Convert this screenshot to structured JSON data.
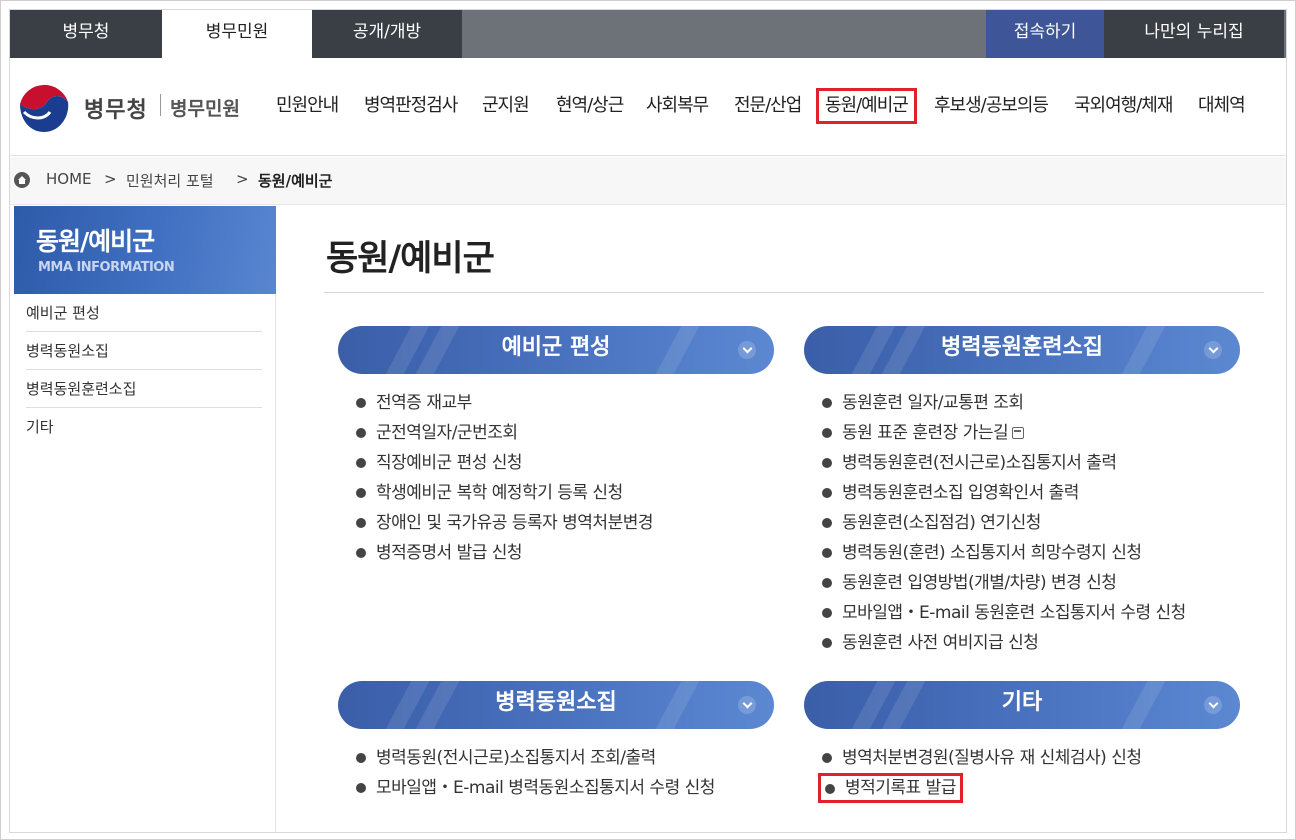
{
  "topbar": {
    "tabs": [
      "병무청",
      "병무민원",
      "공개/개방"
    ],
    "active_tab": "병무민원",
    "login": "접속하기",
    "my_nuri": "나만의 누리집"
  },
  "header": {
    "logo_text": "병무청",
    "logo_sub": "병무민원",
    "nav": [
      "민원안내",
      "병역판정검사",
      "군지원",
      "현역/상근",
      "사회복무",
      "전문/산업",
      "동원/예비군",
      "후보생/공보의등",
      "국외여행/체재",
      "대체역"
    ],
    "active_nav": "동원/예비군"
  },
  "breadcrumb": {
    "home": "HOME",
    "sep": ">",
    "level1": "민원처리 포털",
    "current": "동원/예비군"
  },
  "sidebar": {
    "title": "동원/예비군",
    "subtitle": "MMA INFORMATION",
    "items": [
      "예비군 편성",
      "병력동원소집",
      "병력동원훈련소집",
      "기타"
    ]
  },
  "main": {
    "title": "동원/예비군",
    "sections": [
      {
        "title": "예비군 편성",
        "items": [
          "전역증 재교부",
          "군전역일자/군번조회",
          "직장예비군 편성 신청",
          "학생예비군 복학 예정학기 등록 신청",
          "장애인 및 국가유공 등록자 병역처분변경",
          "병적증명서 발급 신청"
        ]
      },
      {
        "title": "병력동원훈련소집",
        "items": [
          "동원훈련 일자/교통편 조회",
          "동원 표준 훈련장 가는길",
          "병력동원훈련(전시근로)소집통지서 출력",
          "병력동원훈련소집 입영확인서 출력",
          "동원훈련(소집점검) 연기신청",
          "병력동원(훈련) 소집통지서 희망수령지 신청",
          "동원훈련 입영방법(개별/차량) 변경 신청",
          "모바일앱・E-mail 동원훈련 소집통지서 수령 신청",
          "동원훈련 사전 여비지급 신청"
        ]
      },
      {
        "title": "병력동원소집",
        "items": [
          "병력동원(전시근로)소집통지서 조회/출력",
          "모바일앱・E-mail 병력동원소집통지서 수령 신청"
        ]
      },
      {
        "title": "기타",
        "items": [
          "병역처분변경원(질병사유 재 신체검사) 신청",
          "병적기록표 발급"
        ]
      }
    ]
  },
  "colors": {
    "accent_blue": "#3e5697",
    "highlight_red": "#e0202a",
    "dark_tab": "#3a3f45"
  }
}
